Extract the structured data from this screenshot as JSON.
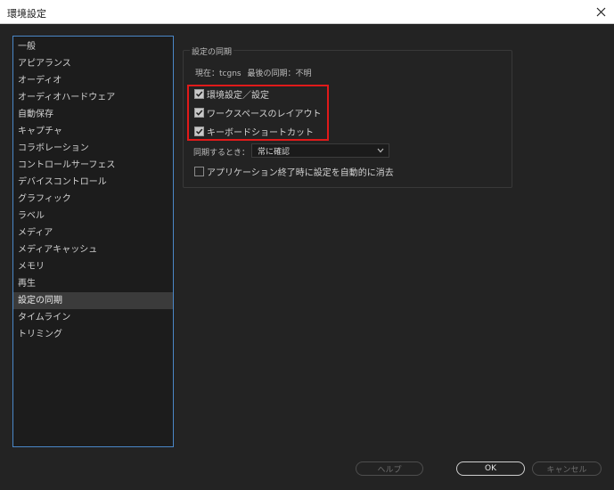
{
  "window": {
    "title": "環境設定",
    "close_icon": "close-icon"
  },
  "sidebar": {
    "items": [
      {
        "label": "一般"
      },
      {
        "label": "アピアランス"
      },
      {
        "label": "オーディオ"
      },
      {
        "label": "オーディオハードウェア"
      },
      {
        "label": "自動保存"
      },
      {
        "label": "キャプチャ"
      },
      {
        "label": "コラボレーション"
      },
      {
        "label": "コントロールサーフェス"
      },
      {
        "label": "デバイスコントロール"
      },
      {
        "label": "グラフィック"
      },
      {
        "label": "ラベル"
      },
      {
        "label": "メディア"
      },
      {
        "label": "メディアキャッシュ"
      },
      {
        "label": "メモリ"
      },
      {
        "label": "再生"
      },
      {
        "label": "設定の同期",
        "selected": true
      },
      {
        "label": "タイムライン"
      },
      {
        "label": "トリミング"
      }
    ]
  },
  "sync_panel": {
    "group_title": "設定の同期",
    "current_label": "現在：tcgns",
    "last_sync_label": "最後の同期：不明",
    "options": [
      {
        "label": "環境設定／設定",
        "checked": true
      },
      {
        "label": "ワークスペースのレイアウト",
        "checked": true
      },
      {
        "label": "キーボードショートカット",
        "checked": true
      }
    ],
    "sync_when_label": "同期するとき：",
    "sync_when_value": "常に確認",
    "clear_on_quit_label": "アプリケーション終了時に設定を自動的に消去",
    "clear_on_quit_checked": false
  },
  "buttons": {
    "help": "ヘルプ",
    "ok": "OK",
    "cancel": "キャンセル"
  },
  "colors": {
    "highlight": "#e01a1a",
    "sidebar_border": "#4a87c8"
  }
}
